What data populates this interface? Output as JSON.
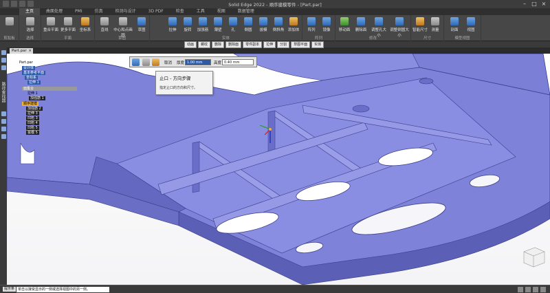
{
  "app": {
    "title": "Solid Edge 2022 - 顺序建模零件 - [Part.par]"
  },
  "ribbon": {
    "tabs": [
      {
        "label": "主页"
      },
      {
        "label": "曲面处理"
      },
      {
        "label": "PMI"
      },
      {
        "label": "仿真"
      },
      {
        "label": "检测与设计"
      },
      {
        "label": "3D PDF"
      },
      {
        "label": "检查"
      },
      {
        "label": "工具"
      },
      {
        "label": "视图"
      },
      {
        "label": "数据管理"
      }
    ],
    "groups": {
      "clipboard": "剪贴板",
      "select": "选择",
      "planes": "平面",
      "sketch": "草图",
      "solids": "实体",
      "pattern": "阵列",
      "modify": "修改",
      "dimension": "尺寸",
      "model_view": "模型视图"
    },
    "buttons": {
      "select": "选择",
      "coincident_plane": "重合平面",
      "more_planes": "更多平面",
      "coord_sys": "坐标系",
      "line": "直线",
      "center_circle": "中心和点画圆",
      "sketch": "草图",
      "extrude": "拉伸",
      "revolve": "旋转",
      "rib": "加强筋",
      "thin_wall": "薄壁",
      "round": "倒圆",
      "chamfer": "倒斜角",
      "hole": "孔",
      "draft": "拔模",
      "add_body": "添加体",
      "pattern": "阵列",
      "mirror": "镜像",
      "move_face": "移动面",
      "delete_face": "删除面",
      "resize": "调整孔大小",
      "resize_round": "调整倒圆大小",
      "smart_dim": "智能尺寸",
      "measure": "测量",
      "section": "剖面",
      "view": "视图"
    }
  },
  "doc_toolbar": {
    "items": [
      "动画",
      "螺纹",
      "删除",
      "删除面",
      "零件副本",
      "拉伸",
      "分割",
      "草图平面",
      "实体"
    ]
  },
  "document": {
    "tab_label": "Part.par"
  },
  "left_panel": {
    "label": "路径查找器"
  },
  "tree": {
    "items": [
      {
        "label": "Part.par",
        "style": "plain"
      },
      {
        "label": "设计体",
        "style": "hl"
      },
      {
        "label": "基本参考平面",
        "style": "hl"
      },
      {
        "label": "坐标系",
        "style": "hl"
      },
      {
        "label": "拉伸 1",
        "style": "hl"
      },
      {
        "label": "面集合",
        "style": "gray"
      },
      {
        "label": "拉伸 1",
        "style": "plain"
      },
      {
        "label": "加强筋 1",
        "style": "dark"
      },
      {
        "label": "顺序建模",
        "style": "sel"
      },
      {
        "label": "加强筋 2",
        "style": "dark"
      },
      {
        "label": "拉伸 3",
        "style": "dark"
      },
      {
        "label": "凹陷 3",
        "style": "dark"
      },
      {
        "label": "凹陷 4",
        "style": "dark"
      },
      {
        "label": "凹陷 5",
        "style": "dark"
      },
      {
        "label": "拔模 5",
        "style": "dark"
      }
    ]
  },
  "command_bar": {
    "cancel_label": "取消",
    "thickness_label": "厚度",
    "thickness_value": "1.00 mm",
    "height_label": "高度",
    "height_value": "0.40 mm"
  },
  "tooltip": {
    "title": "止口 - 方向步骤",
    "desc": "指定止口的方向和尺寸。"
  },
  "status_bar": {
    "label": "提示条",
    "message": "单击以接受显示的一侧或选择视图中的另一侧。"
  },
  "colors": {
    "part_face": "#7b7fd6",
    "part_dark": "#5b5fb5",
    "viewport_bg": "#ffffff",
    "ribbon_bg": "#474747",
    "selection_highlight": "#f0b030"
  }
}
